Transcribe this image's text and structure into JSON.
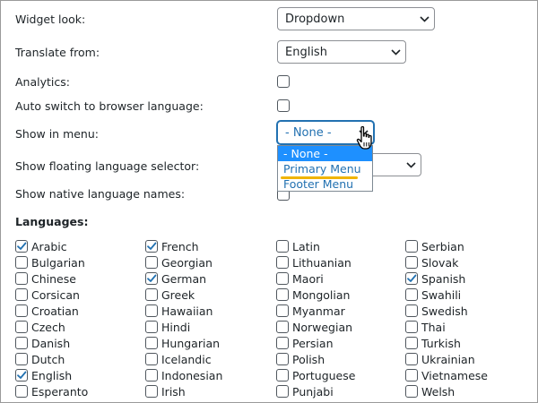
{
  "settings": {
    "widget_look": {
      "label": "Widget look:",
      "value": "Dropdown"
    },
    "translate_from": {
      "label": "Translate from:",
      "value": "English"
    },
    "analytics": {
      "label": "Analytics:",
      "checked": false
    },
    "auto_switch": {
      "label": "Auto switch to browser language:",
      "checked": false
    },
    "show_in_menu": {
      "label": "Show in menu:",
      "value": "- None -",
      "options": [
        "- None -",
        "Primary Menu",
        "Footer Menu"
      ],
      "open": true
    },
    "floating_selector": {
      "label": "Show floating language selector:"
    },
    "native_names": {
      "label": "Show native language names:",
      "checked": false
    }
  },
  "languages": {
    "title": "Languages:",
    "columns": [
      [
        {
          "name": "Arabic",
          "checked": true
        },
        {
          "name": "Bulgarian",
          "checked": false
        },
        {
          "name": "Chinese",
          "checked": false
        },
        {
          "name": "Corsican",
          "checked": false
        },
        {
          "name": "Croatian",
          "checked": false
        },
        {
          "name": "Czech",
          "checked": false
        },
        {
          "name": "Danish",
          "checked": false
        },
        {
          "name": "Dutch",
          "checked": false
        },
        {
          "name": "English",
          "checked": true
        },
        {
          "name": "Esperanto",
          "checked": false
        }
      ],
      [
        {
          "name": "French",
          "checked": true
        },
        {
          "name": "Georgian",
          "checked": false
        },
        {
          "name": "German",
          "checked": true
        },
        {
          "name": "Greek",
          "checked": false
        },
        {
          "name": "Hawaiian",
          "checked": false
        },
        {
          "name": "Hindi",
          "checked": false
        },
        {
          "name": "Hungarian",
          "checked": false
        },
        {
          "name": "Icelandic",
          "checked": false
        },
        {
          "name": "Indonesian",
          "checked": false
        },
        {
          "name": "Irish",
          "checked": false
        }
      ],
      [
        {
          "name": "Latin",
          "checked": false
        },
        {
          "name": "Lithuanian",
          "checked": false
        },
        {
          "name": "Maori",
          "checked": false
        },
        {
          "name": "Mongolian",
          "checked": false
        },
        {
          "name": "Myanmar",
          "checked": false
        },
        {
          "name": "Norwegian",
          "checked": false
        },
        {
          "name": "Persian",
          "checked": false
        },
        {
          "name": "Polish",
          "checked": false
        },
        {
          "name": "Portuguese",
          "checked": false
        },
        {
          "name": "Punjabi",
          "checked": false
        }
      ],
      [
        {
          "name": "Serbian",
          "checked": false
        },
        {
          "name": "Slovak",
          "checked": false
        },
        {
          "name": "Spanish",
          "checked": true
        },
        {
          "name": "Swahili",
          "checked": false
        },
        {
          "name": "Swedish",
          "checked": false
        },
        {
          "name": "Thai",
          "checked": false
        },
        {
          "name": "Turkish",
          "checked": false
        },
        {
          "name": "Ukrainian",
          "checked": false
        },
        {
          "name": "Vietnamese",
          "checked": false
        },
        {
          "name": "Welsh",
          "checked": false
        }
      ]
    ]
  },
  "colors": {
    "accent": "#2271b1",
    "selected_option_bg": "#1e90ff",
    "highlight_underline": "#f0b400"
  },
  "icons": {
    "select_arrow": "chevron-down-icon",
    "checkbox_mark": "checkmark-icon",
    "pointer": "hand-pointer-icon"
  }
}
